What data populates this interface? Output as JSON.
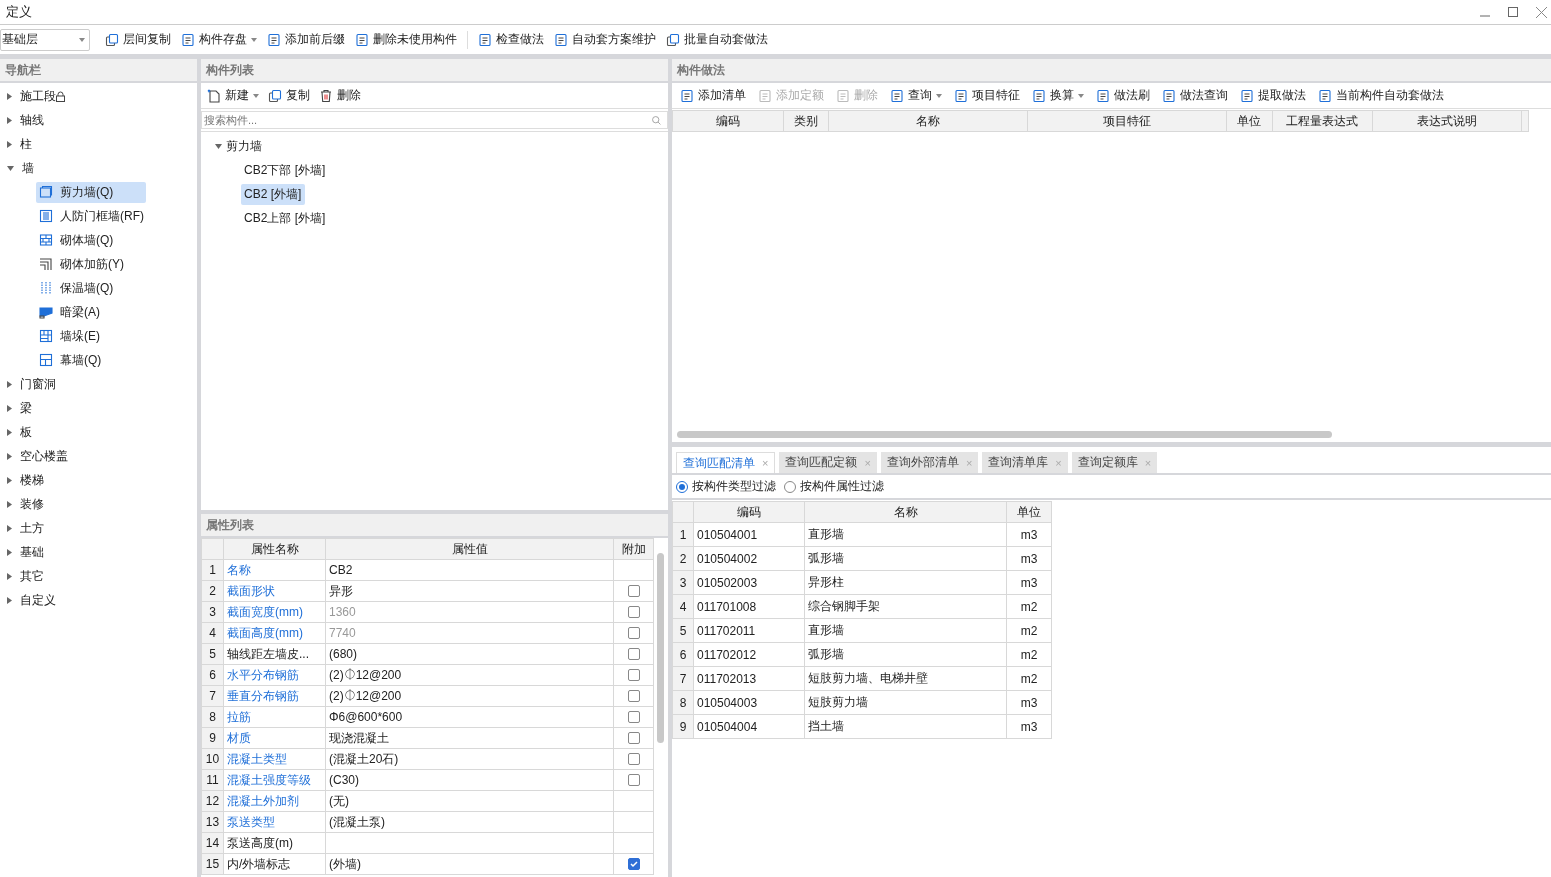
{
  "window": {
    "title": "定义"
  },
  "toolbar": {
    "floor_select": "基础层",
    "items": [
      {
        "label": "层间复制",
        "dropdown": false
      },
      {
        "label": "构件存盘",
        "dropdown": true
      },
      {
        "label": "添加前后缀",
        "dropdown": false
      },
      {
        "label": "删除未使用构件",
        "dropdown": false
      },
      {
        "label": "检查做法",
        "dropdown": false
      },
      {
        "label": "自动套方案维护",
        "dropdown": false
      },
      {
        "label": "批量自动套做法",
        "dropdown": false
      }
    ]
  },
  "nav": {
    "title": "导航栏",
    "items": [
      {
        "label": "施工段",
        "expanded": false,
        "locked": true
      },
      {
        "label": "轴线",
        "expanded": false,
        "locked": false
      },
      {
        "label": "柱",
        "expanded": false,
        "locked": false
      },
      {
        "label": "墙",
        "expanded": true,
        "locked": false,
        "children": [
          {
            "label": "剪力墙(Q)",
            "selected": true
          },
          {
            "label": "人防门框墙(RF)",
            "selected": false
          },
          {
            "label": "砌体墙(Q)",
            "selected": false
          },
          {
            "label": "砌体加筋(Y)",
            "selected": false
          },
          {
            "label": "保温墙(Q)",
            "selected": false
          },
          {
            "label": "暗梁(A)",
            "selected": false
          },
          {
            "label": "墙垛(E)",
            "selected": false
          },
          {
            "label": "幕墙(Q)",
            "selected": false
          }
        ]
      },
      {
        "label": "门窗洞",
        "expanded": false,
        "locked": false
      },
      {
        "label": "梁",
        "expanded": false,
        "locked": false
      },
      {
        "label": "板",
        "expanded": false,
        "locked": false
      },
      {
        "label": "空心楼盖",
        "expanded": false,
        "locked": false
      },
      {
        "label": "楼梯",
        "expanded": false,
        "locked": false
      },
      {
        "label": "装修",
        "expanded": false,
        "locked": false
      },
      {
        "label": "土方",
        "expanded": false,
        "locked": false
      },
      {
        "label": "基础",
        "expanded": false,
        "locked": false
      },
      {
        "label": "其它",
        "expanded": false,
        "locked": false
      },
      {
        "label": "自定义",
        "expanded": false,
        "locked": false
      }
    ]
  },
  "component_list": {
    "title": "构件列表",
    "toolbar": [
      {
        "label": "新建",
        "dropdown": true
      },
      {
        "label": "复制",
        "dropdown": false
      },
      {
        "label": "删除",
        "dropdown": false
      }
    ],
    "search": {
      "placeholder": "搜索构件..."
    },
    "tree": [
      {
        "label": "剪力墙",
        "expanded": true,
        "children": [
          {
            "label": "CB2下部 [外墙]",
            "selected": false
          },
          {
            "label": "CB2 [外墙]",
            "selected": true
          },
          {
            "label": "CB2上部 [外墙]",
            "selected": false
          }
        ]
      }
    ]
  },
  "properties": {
    "title": "属性列表",
    "columns": [
      "属性名称",
      "属性值",
      "附加"
    ],
    "rows": [
      {
        "index": "1",
        "name": "名称",
        "value": "CB2",
        "public": true,
        "greyed": false
      },
      {
        "index": "2",
        "name": "截面形状",
        "value": "异形",
        "public": true,
        "greyed": false,
        "checked": false
      },
      {
        "index": "3",
        "name": "截面宽度(mm)",
        "value": "1360",
        "public": true,
        "greyed": true,
        "checked": false
      },
      {
        "index": "4",
        "name": "截面高度(mm)",
        "value": "7740",
        "public": true,
        "greyed": true,
        "checked": false
      },
      {
        "index": "5",
        "name": "轴线距左墙皮...",
        "value": "(680)",
        "public": false,
        "greyed": false,
        "checked": false
      },
      {
        "index": "6",
        "name": "水平分布钢筋",
        "value": "(2)⏀12@200",
        "public": true,
        "greyed": false,
        "checked": false
      },
      {
        "index": "7",
        "name": "垂直分布钢筋",
        "value": "(2)⏀12@200",
        "public": true,
        "greyed": false,
        "checked": false
      },
      {
        "index": "8",
        "name": "拉筋",
        "value": "Φ6@600*600",
        "public": true,
        "greyed": false,
        "checked": false
      },
      {
        "index": "9",
        "name": "材质",
        "value": "现浇混凝土",
        "public": true,
        "greyed": false,
        "checked": false
      },
      {
        "index": "10",
        "name": "混凝土类型",
        "value": "(混凝土20石)",
        "public": true,
        "greyed": false,
        "checked": false
      },
      {
        "index": "11",
        "name": "混凝土强度等级",
        "value": "(C30)",
        "public": true,
        "greyed": false,
        "checked": false
      },
      {
        "index": "12",
        "name": "混凝土外加剂",
        "value": "(无)",
        "public": true,
        "greyed": false
      },
      {
        "index": "13",
        "name": "泵送类型",
        "value": "(混凝土泵)",
        "public": true,
        "greyed": false
      },
      {
        "index": "14",
        "name": "泵送高度(m)",
        "public": false
      },
      {
        "index": "15",
        "name": "内/外墙标志",
        "value": "(外墙)",
        "public": false,
        "greyed": false,
        "checked": true
      }
    ]
  },
  "methods": {
    "title": "构件做法",
    "toolbar": [
      {
        "label": "添加清单",
        "disabled": false,
        "dropdown": false
      },
      {
        "label": "添加定额",
        "disabled": true,
        "dropdown": false
      },
      {
        "label": "删除",
        "disabled": true,
        "dropdown": false
      },
      {
        "label": "查询",
        "disabled": false,
        "dropdown": true
      },
      {
        "label": "项目特征",
        "disabled": false,
        "dropdown": false
      },
      {
        "label": "换算",
        "disabled": false,
        "dropdown": true
      },
      {
        "label": "做法刷",
        "disabled": false,
        "dropdown": false
      },
      {
        "label": "做法查询",
        "disabled": false,
        "dropdown": false
      },
      {
        "label": "提取做法",
        "disabled": false,
        "dropdown": false
      },
      {
        "label": "当前构件自动套做法",
        "disabled": false,
        "dropdown": false
      }
    ],
    "columns": [
      "编码",
      "类别",
      "名称",
      "项目特征",
      "单位",
      "工程量表达式",
      "表达式说明"
    ]
  },
  "query": {
    "tabs": [
      {
        "label": "查询匹配清单",
        "selected": true,
        "close": "×"
      },
      {
        "label": "查询匹配定额",
        "selected": false,
        "close": "×"
      },
      {
        "label": "查询外部清单",
        "selected": false,
        "close": "×"
      },
      {
        "label": "查询清单库",
        "selected": false,
        "close": "×"
      },
      {
        "label": "查询定额库",
        "selected": false,
        "close": "×"
      }
    ],
    "filters": [
      {
        "label": "按构件类型过滤",
        "selected": true
      },
      {
        "label": "按构件属性过滤",
        "selected": false
      }
    ],
    "columns": [
      "编码",
      "名称",
      "单位"
    ],
    "rows": [
      {
        "index": "1",
        "code": "010504001",
        "name": "直形墙",
        "unit": "m3"
      },
      {
        "index": "2",
        "code": "010504002",
        "name": "弧形墙",
        "unit": "m3"
      },
      {
        "index": "3",
        "code": "010502003",
        "name": "异形柱",
        "unit": "m3"
      },
      {
        "index": "4",
        "code": "011701008",
        "name": "综合钢脚手架",
        "unit": "m2"
      },
      {
        "index": "5",
        "code": "011702011",
        "name": "直形墙",
        "unit": "m2"
      },
      {
        "index": "6",
        "code": "011702012",
        "name": "弧形墙",
        "unit": "m2"
      },
      {
        "index": "7",
        "code": "011702013",
        "name": "短肢剪力墙、电梯井壁",
        "unit": "m2"
      },
      {
        "index": "8",
        "code": "010504003",
        "name": "短肢剪力墙",
        "unit": "m3"
      },
      {
        "index": "9",
        "code": "010504004",
        "name": "挡土墙",
        "unit": "m3"
      }
    ]
  }
}
